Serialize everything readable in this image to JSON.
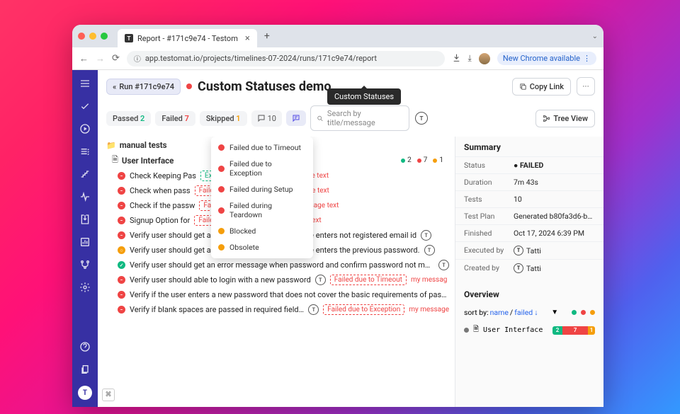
{
  "browser": {
    "tab_title": "Report - #171c9e74 - Testom",
    "url": "app.testomat.io/projects/timelines-07-2024/runs/171c9e74/report",
    "new_chrome": "New Chrome available"
  },
  "page": {
    "back_label": "Run #171c9e74",
    "title": "Custom Statuses demo",
    "tooltip": "Custom Statuses",
    "copy_link": "Copy Link",
    "passed_label": "Passed",
    "passed_count": "2",
    "failed_label": "Failed",
    "failed_count": "7",
    "skipped_label": "Skipped",
    "skipped_count": "1",
    "msg_count": "10",
    "search_placeholder": "Search by title/message",
    "tree_view": "Tree View"
  },
  "legend": {
    "g": "2",
    "r": "7",
    "y": "1"
  },
  "folder": "manual tests",
  "file": "User Interface",
  "dropdown": [
    "Failed due to Timeout",
    "Failed due to Exception",
    "Failed during Setup",
    "Failed during Teardown",
    "Blocked",
    "Obsolete"
  ],
  "tests": [
    {
      "s": "fail",
      "name": "Check Keeping Pas",
      "tag": "Expected behaviour",
      "tagc": "green",
      "msg": "my message text"
    },
    {
      "s": "fail",
      "name": "Check when pass",
      "tag": "Failed due to Timeout",
      "tagc": "red",
      "msg": "my message text"
    },
    {
      "s": "fail",
      "name": "Check if the passw",
      "tag": "Failed due to Exception",
      "tagc": "red",
      "msg": "my message text"
    },
    {
      "s": "fail",
      "name": "Signup Option for",
      "tag": "Failed during Setup",
      "tagc": "red",
      "msg": "my message text"
    },
    {
      "s": "fail",
      "name": "Verify user should get an error message when he/she enters not registered email id",
      "tic": true
    },
    {
      "s": "skip",
      "name": "Verify user should get an error message when he/she enters the previous password.",
      "tic": true
    },
    {
      "s": "pass",
      "name": "Verify user should get an error message when password and confirm password not matches",
      "tic": true
    },
    {
      "s": "fail",
      "name": "Verify user should able to login with a new password",
      "tic": true,
      "tag": "Failed due to Timeout",
      "tagc": "red",
      "msg": "my messag"
    },
    {
      "s": "fail",
      "name": "Verify if the user enters a new password that does not cover the basic requirements of passwo"
    },
    {
      "s": "fail",
      "name": "Verify if blank spaces are passed in required fields.",
      "tic": true,
      "tag": "Failed due to Exception",
      "tagc": "red",
      "msg": "my message"
    }
  ],
  "summary": {
    "title": "Summary",
    "status_k": "Status",
    "status_v": "● FAILED",
    "duration_k": "Duration",
    "duration_v": "7m 43s",
    "tests_k": "Tests",
    "tests_v": "10",
    "plan_k": "Test Plan",
    "plan_v": "Generated b80fa3d6-bd80-4d10-...",
    "finished_k": "Finished",
    "finished_v": "Oct 17, 2024 6:39 PM",
    "exec_k": "Executed by",
    "exec_v": "Tatti",
    "created_k": "Created by",
    "created_v": "Tatti"
  },
  "overview": {
    "title": "Overview",
    "sortby": "sort by:",
    "name": "name",
    "slash": "/",
    "failed": "failed",
    "arrow": "↓",
    "ui": "User Interface",
    "bar": {
      "g": "2",
      "r": "7",
      "y": "1"
    }
  }
}
